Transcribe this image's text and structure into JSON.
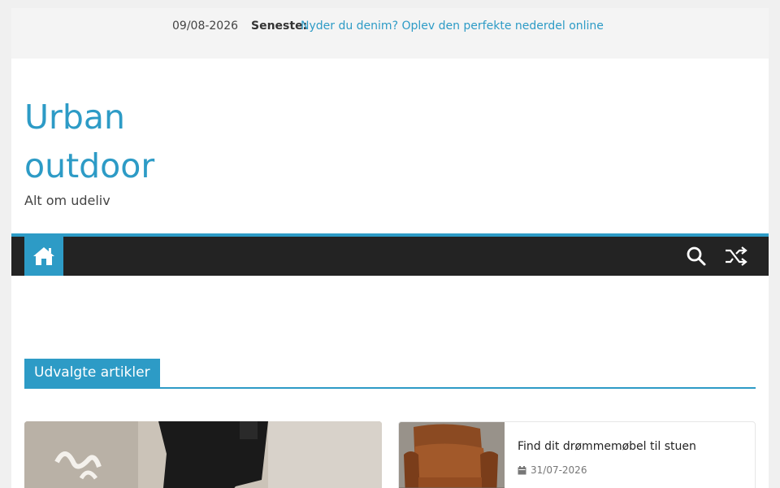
{
  "topbar": {
    "date": "09/08-2026",
    "latest_label": "Seneste:",
    "latest_link": "Nyder du denim? Oplev den perfekte nederdel online"
  },
  "header": {
    "title_line1": "Urban",
    "title_line2": "outdoor",
    "tagline": "Alt om udeliv"
  },
  "nav": {
    "home_icon": "home-icon",
    "search_icon": "search-icon",
    "random_icon": "shuffle-icon"
  },
  "featured": {
    "heading": "Udvalgte artikler",
    "posts": [
      {
        "title": "",
        "date": ""
      },
      {
        "title": "Find dit drømmemøbel til stuen",
        "date": "31/07-2026"
      }
    ]
  },
  "colors": {
    "accent": "#2d9bc6",
    "nav_bg": "#232323",
    "topbar_bg": "#f4f4f4"
  }
}
